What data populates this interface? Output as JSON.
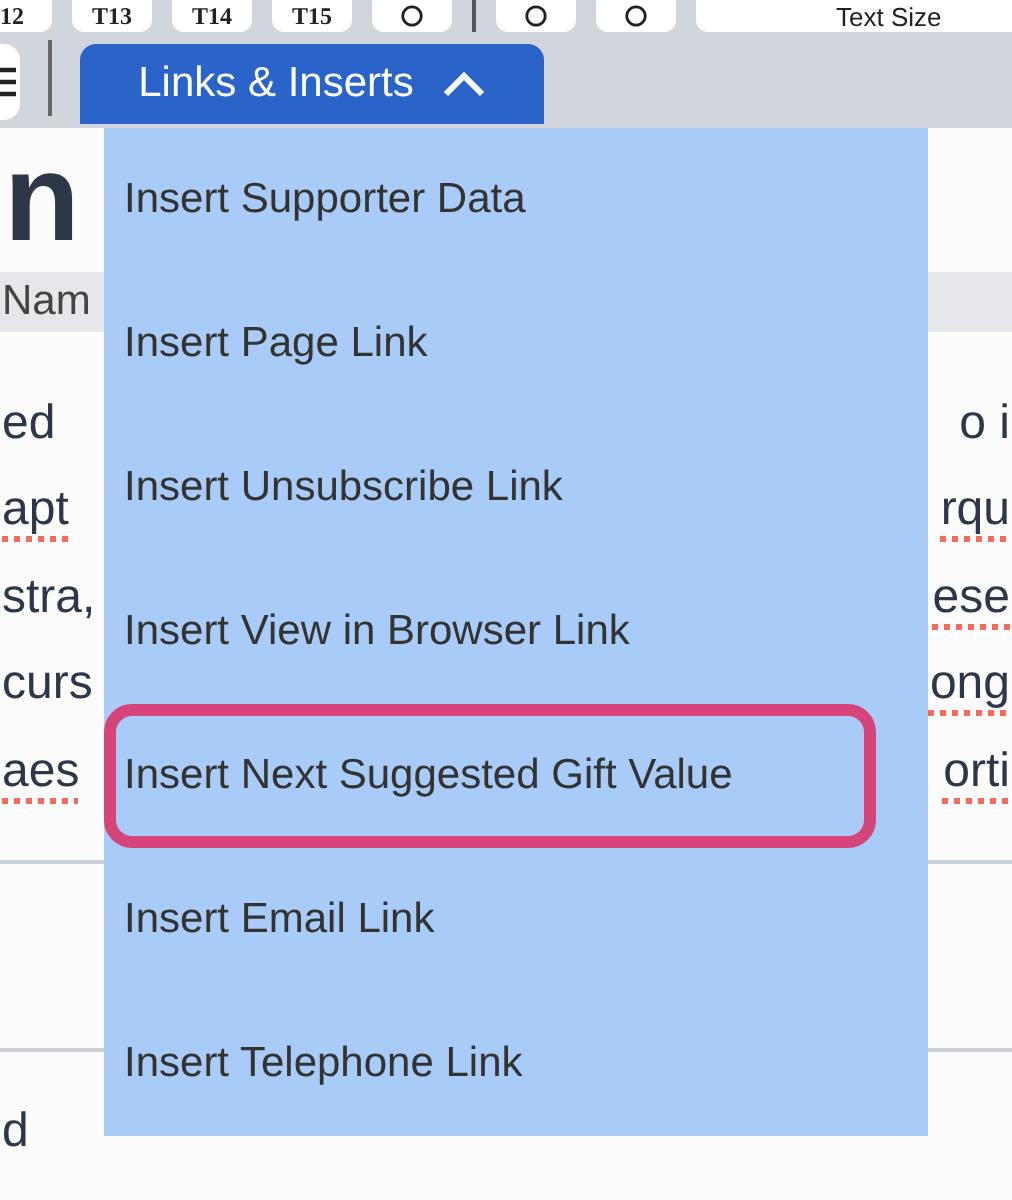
{
  "toolbar_top": {
    "buttons": [
      {
        "kind": "text",
        "label": "12"
      },
      {
        "kind": "text",
        "label": "T13"
      },
      {
        "kind": "text",
        "label": "T14"
      },
      {
        "kind": "text",
        "label": "T15"
      },
      {
        "kind": "icon"
      },
      {
        "kind": "divider"
      },
      {
        "kind": "icon"
      },
      {
        "kind": "icon"
      }
    ],
    "text_size": "Text Size"
  },
  "dropdown": {
    "label": "Links & Inserts",
    "expanded": true,
    "items": [
      {
        "label": "Insert Supporter Data",
        "highlighted": false
      },
      {
        "label": "Insert Page Link",
        "highlighted": false
      },
      {
        "label": "Insert Unsubscribe Link",
        "highlighted": false
      },
      {
        "label": "Insert View in Browser Link",
        "highlighted": false
      },
      {
        "label": "Insert Next Suggested Gift Value",
        "highlighted": true
      },
      {
        "label": "Insert Email Link",
        "highlighted": false
      },
      {
        "label": "Insert Telephone Link",
        "highlighted": false
      }
    ]
  },
  "editor": {
    "heading": "n",
    "band": "Nam",
    "lines": [
      {
        "left": "ed",
        "left_misspelled": false,
        "right": "o i",
        "right_misspelled": false
      },
      {
        "left": "apt",
        "left_misspelled": true,
        "right": "rqu",
        "right_misspelled": true
      },
      {
        "left": "stra,",
        "left_misspelled": false,
        "right": "ese",
        "right_misspelled": true
      },
      {
        "left": "curs",
        "left_misspelled": false,
        "right": "ong",
        "right_misspelled": true
      },
      {
        "left": "aes",
        "left_misspelled": true,
        "right": "orti",
        "right_misspelled": true
      }
    ],
    "footer": "d"
  }
}
